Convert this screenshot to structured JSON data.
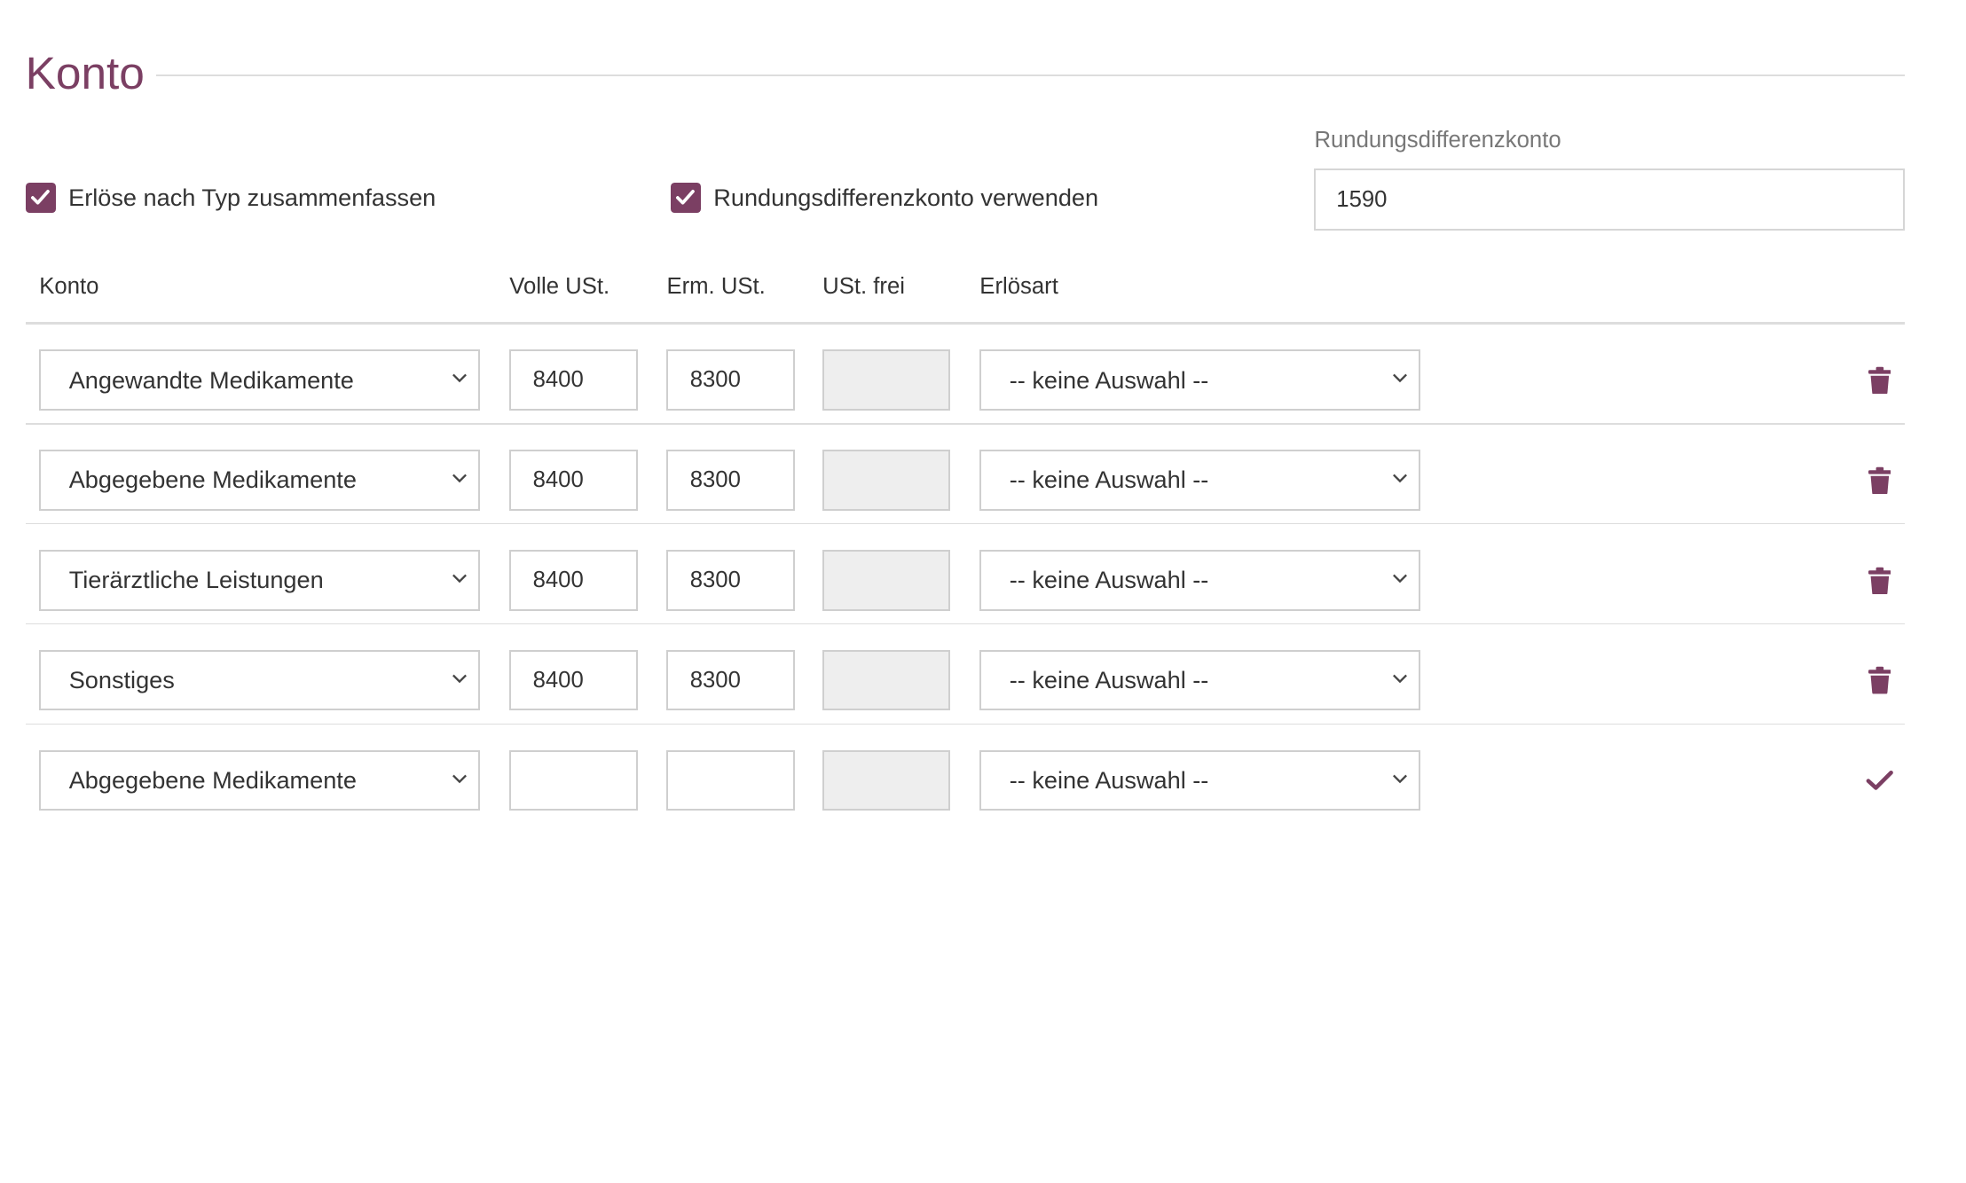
{
  "section": {
    "title": "Konto"
  },
  "options": {
    "group_revenue_label": "Erlöse nach Typ zusammenfassen",
    "group_revenue_checked": true,
    "use_rounding_label": "Rundungsdifferenzkonto verwenden",
    "use_rounding_checked": true,
    "rounding_account_label": "Rundungsdifferenzkonto",
    "rounding_account_value": "1590"
  },
  "table": {
    "headers": [
      "Konto",
      "Volle USt.",
      "Erm. USt.",
      "USt. frei",
      "Erlösart"
    ],
    "rows": [
      {
        "konto": "Angewandte Medikamente",
        "volle": "8400",
        "erm": "8300",
        "frei": "",
        "erloesart": "-- keine Auswahl --",
        "action": "trash-icon"
      },
      {
        "konto": "Abgegebene Medikamente",
        "volle": "8400",
        "erm": "8300",
        "frei": "",
        "erloesart": "-- keine Auswahl --",
        "action": "trash-icon"
      },
      {
        "konto": "Tierärztliche Leistungen",
        "volle": "8400",
        "erm": "8300",
        "frei": "",
        "erloesart": "-- keine Auswahl --",
        "action": "trash-icon"
      },
      {
        "konto": "Sonstiges",
        "volle": "8400",
        "erm": "8300",
        "frei": "",
        "erloesart": "-- keine Auswahl --",
        "action": "trash-icon"
      },
      {
        "konto": "Abgegebene Medikamente",
        "volle": "",
        "erm": "",
        "frei": "",
        "erloesart": "-- keine Auswahl --",
        "action": "checkmark-icon"
      }
    ]
  },
  "colors": {
    "accent": "#7b3f63",
    "border": "#cfcfcf",
    "disabled_bg": "#eeeeee",
    "divider": "#dddddd"
  }
}
